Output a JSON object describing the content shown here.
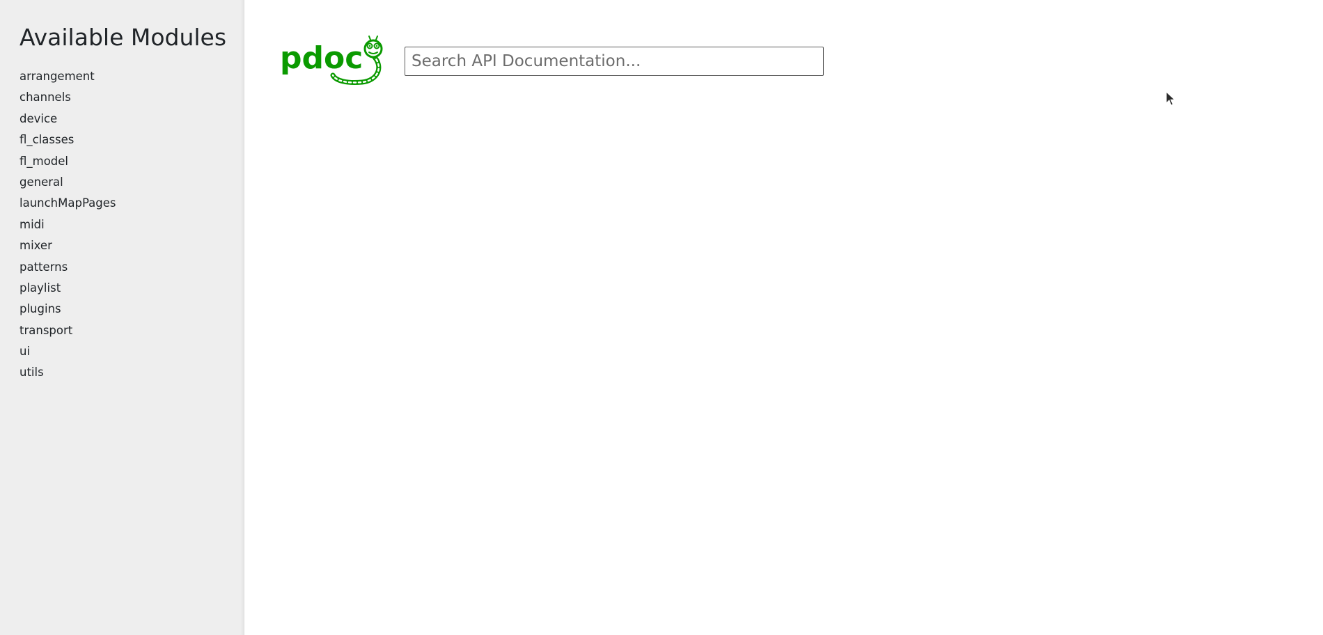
{
  "sidebar": {
    "title": "Available Modules",
    "modules": [
      {
        "label": "arrangement"
      },
      {
        "label": "channels"
      },
      {
        "label": "device"
      },
      {
        "label": "fl_classes"
      },
      {
        "label": "fl_model"
      },
      {
        "label": "general"
      },
      {
        "label": "launchMapPages"
      },
      {
        "label": "midi"
      },
      {
        "label": "mixer"
      },
      {
        "label": "patterns"
      },
      {
        "label": "playlist"
      },
      {
        "label": "plugins"
      },
      {
        "label": "transport"
      },
      {
        "label": "ui"
      },
      {
        "label": "utils"
      }
    ]
  },
  "header": {
    "logo_text": "pdoc",
    "logo_icon": "pdoc-snake-logo",
    "brand_color": "#0a9a00"
  },
  "search": {
    "placeholder": "Search API Documentation...",
    "value": ""
  },
  "colors": {
    "sidebar_bg": "#eeeeee",
    "text": "#212529",
    "page_bg": "#ffffff"
  }
}
